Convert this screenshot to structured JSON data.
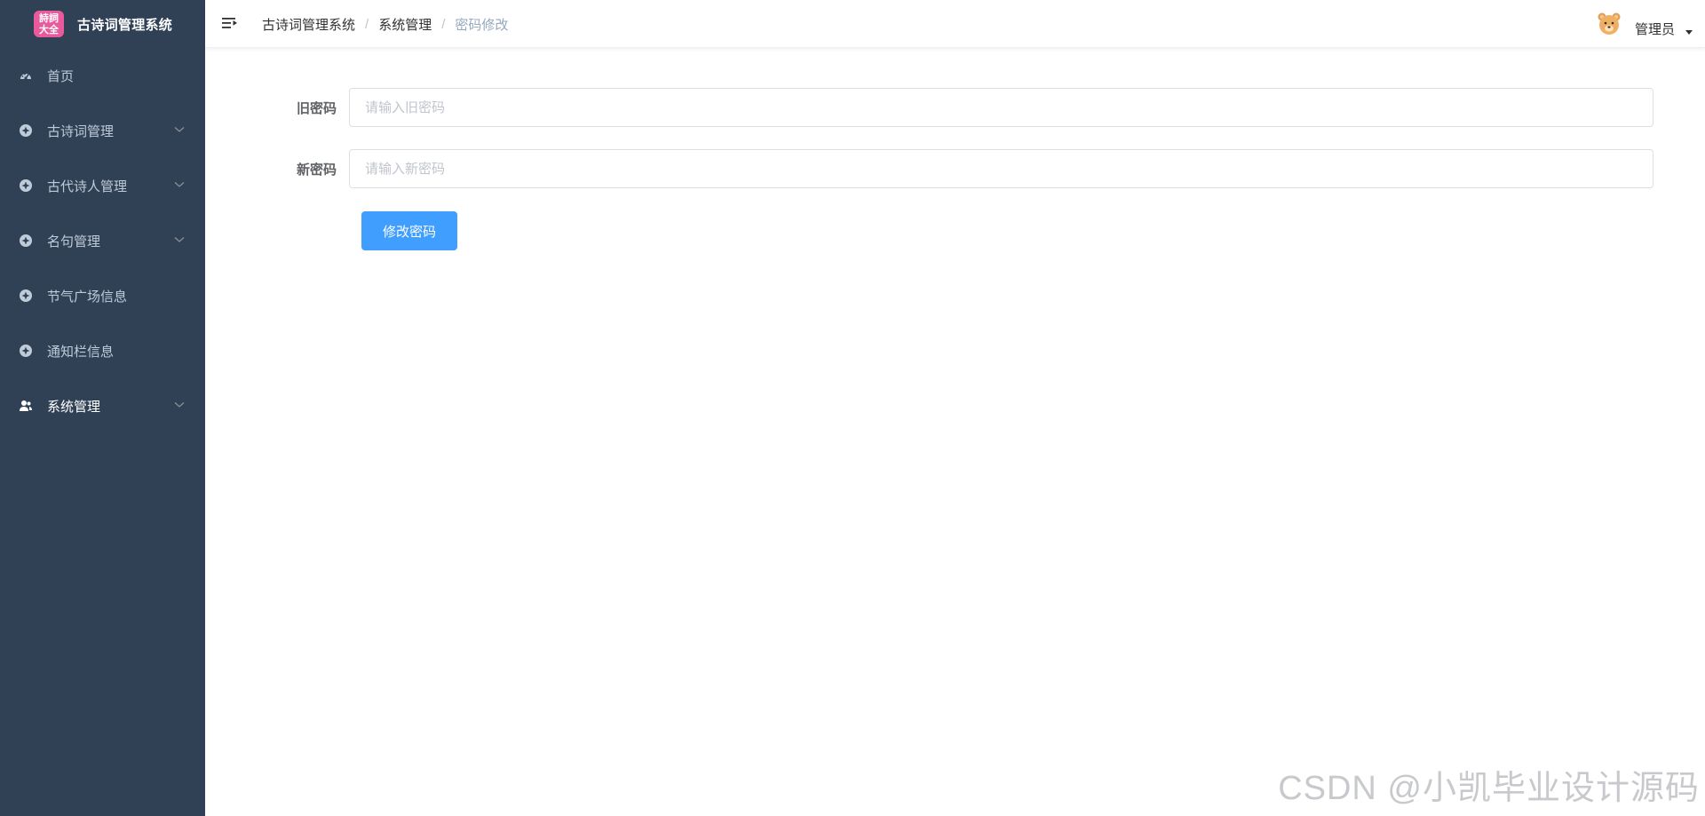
{
  "app": {
    "title": "古诗词管理系统",
    "logo_text_top": "詩詞",
    "logo_text_bottom": "大全"
  },
  "sidebar": {
    "items": [
      {
        "label": "首页",
        "icon": "dashboard-icon",
        "has_submenu": false
      },
      {
        "label": "古诗词管理",
        "icon": "circle-plus-icon",
        "has_submenu": true
      },
      {
        "label": "古代诗人管理",
        "icon": "circle-plus-icon",
        "has_submenu": true
      },
      {
        "label": "名句管理",
        "icon": "circle-plus-icon",
        "has_submenu": true
      },
      {
        "label": "节气广场信息",
        "icon": "circle-plus-icon",
        "has_submenu": false
      },
      {
        "label": "通知栏信息",
        "icon": "circle-plus-icon",
        "has_submenu": false
      },
      {
        "label": "系统管理",
        "icon": "user-icon",
        "has_submenu": true,
        "active": true
      }
    ]
  },
  "header": {
    "breadcrumb": [
      "古诗词管理系统",
      "系统管理",
      "密码修改"
    ],
    "username": "管理员",
    "avatar_icon": "bear-avatar-icon"
  },
  "form": {
    "old_password": {
      "label": "旧密码",
      "placeholder": "请输入旧密码",
      "value": ""
    },
    "new_password": {
      "label": "新密码",
      "placeholder": "请输入新密码",
      "value": ""
    },
    "submit_label": "修改密码"
  },
  "watermark": "CSDN @小凯毕业设计源码",
  "colors": {
    "sidebar_bg": "#304156",
    "sidebar_text": "#bfcbd9",
    "primary": "#409eff",
    "breadcrumb_current": "#97a8be"
  }
}
